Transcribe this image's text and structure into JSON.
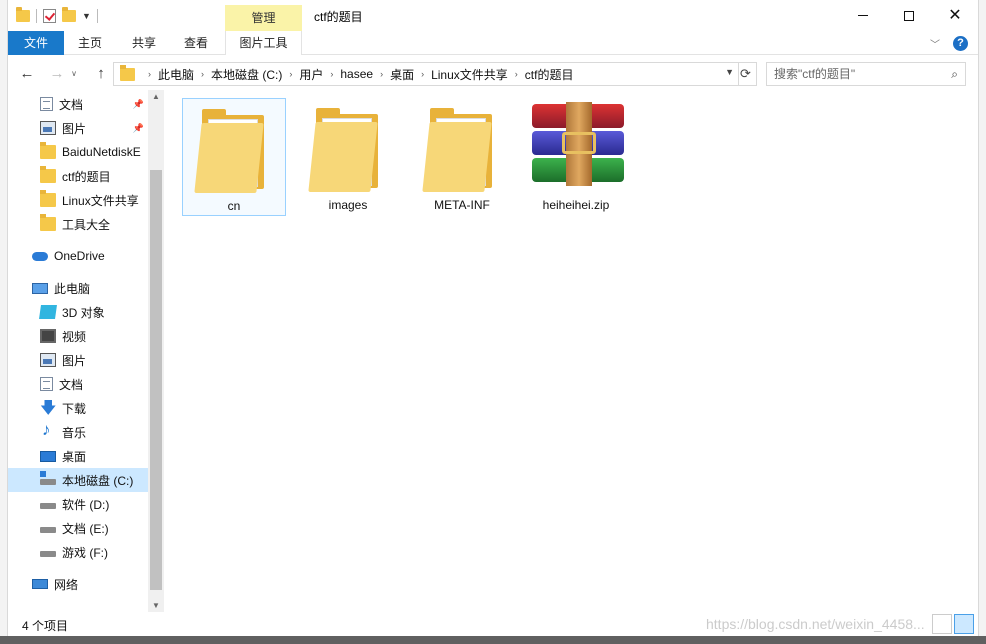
{
  "window": {
    "title": "ctf的题目",
    "context_group_label": "管理"
  },
  "ribbon": {
    "tabs": [
      "文件",
      "主页",
      "共享",
      "查看",
      "图片工具"
    ],
    "accent_color": "#1979ca",
    "context_color": "#faf3a8"
  },
  "address": {
    "breadcrumbs": [
      "此电脑",
      "本地磁盘 (C:)",
      "用户",
      "hasee",
      "桌面",
      "Linux文件共享",
      "ctf的题目"
    ],
    "search_placeholder": "搜索\"ctf的题目\""
  },
  "nav_pane": {
    "quick_access": [
      {
        "label": "文档",
        "icon": "document-icon",
        "pinned": true
      },
      {
        "label": "图片",
        "icon": "picture-icon",
        "pinned": true
      },
      {
        "label": "BaiduNetdiskE",
        "icon": "folder-icon",
        "pinned": false
      },
      {
        "label": "ctf的题目",
        "icon": "folder-icon",
        "pinned": false
      },
      {
        "label": "Linux文件共享",
        "icon": "folder-icon",
        "pinned": false
      },
      {
        "label": "工具大全",
        "icon": "folder-icon",
        "pinned": false
      }
    ],
    "onedrive": "OneDrive",
    "this_pc": "此电脑",
    "pc_items": [
      {
        "label": "3D 对象",
        "icon": "3d-objects-icon"
      },
      {
        "label": "视频",
        "icon": "video-icon"
      },
      {
        "label": "图片",
        "icon": "picture-icon"
      },
      {
        "label": "文档",
        "icon": "document-icon"
      },
      {
        "label": "下载",
        "icon": "download-icon"
      },
      {
        "label": "音乐",
        "icon": "music-icon"
      },
      {
        "label": "桌面",
        "icon": "desktop-icon"
      },
      {
        "label": "本地磁盘 (C:)",
        "icon": "drive-c-icon",
        "selected": true
      },
      {
        "label": "软件 (D:)",
        "icon": "drive-icon"
      },
      {
        "label": "文档 (E:)",
        "icon": "drive-icon"
      },
      {
        "label": "游戏 (F:)",
        "icon": "drive-icon"
      }
    ],
    "network": "网络"
  },
  "files": [
    {
      "name": "cn",
      "type": "folder",
      "selected": true
    },
    {
      "name": "images",
      "type": "folder"
    },
    {
      "name": "META-INF",
      "type": "folder"
    },
    {
      "name": "heiheihei.zip",
      "type": "winrar-archive"
    }
  ],
  "status": {
    "item_count": "4 个项目"
  },
  "watermark": "https://blog.csdn.net/weixin_4458..."
}
